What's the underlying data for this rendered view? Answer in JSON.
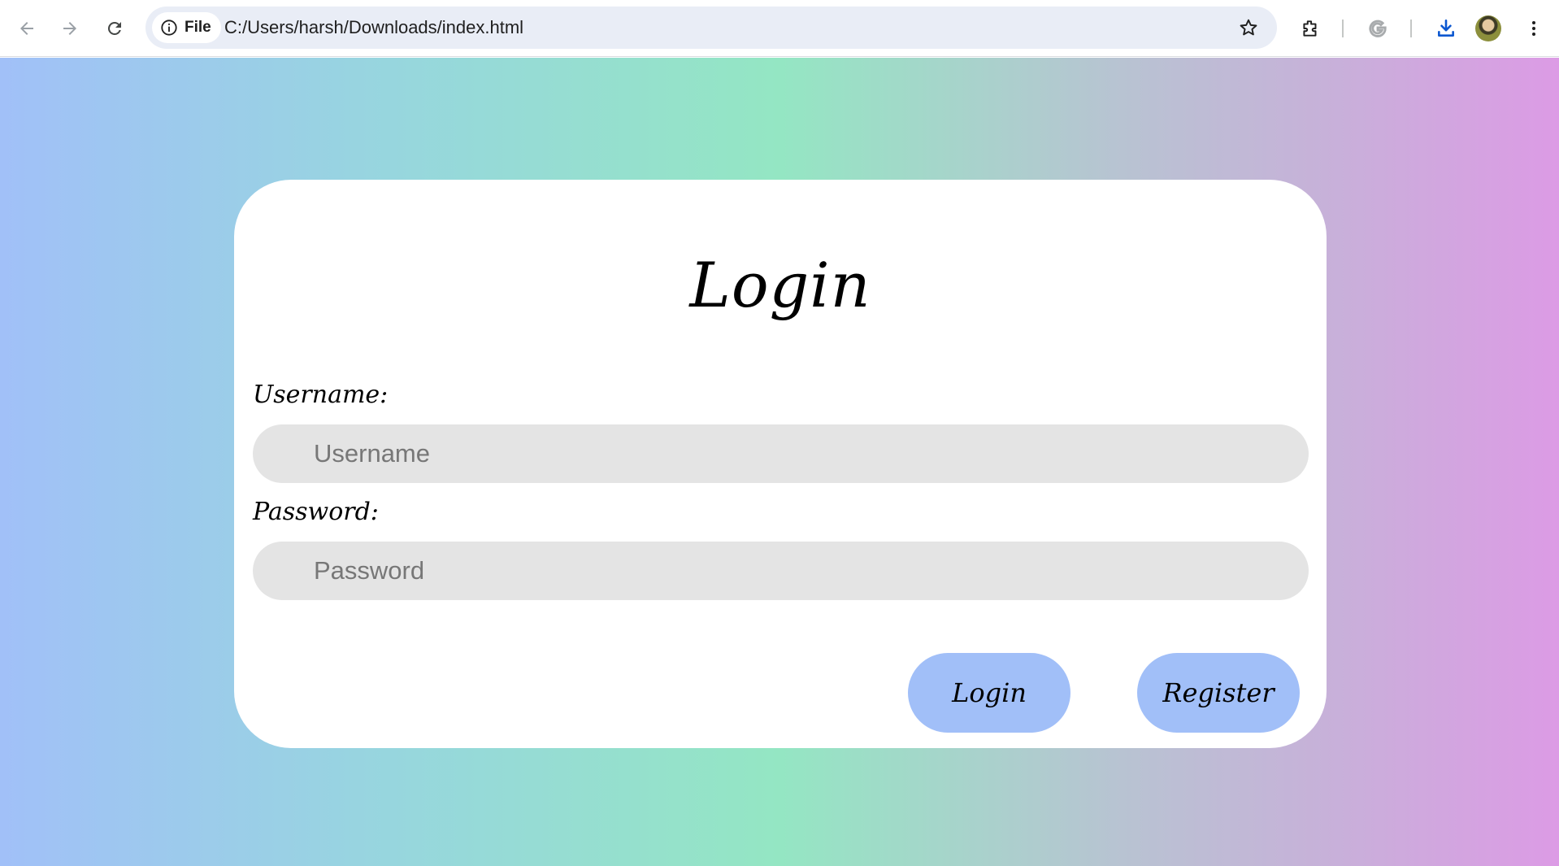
{
  "browser": {
    "site_info": "File",
    "url": "C:/Users/harsh/Downloads/index.html",
    "icons": [
      "back-arrow-icon",
      "forward-arrow-icon",
      "reload-icon",
      "info-icon",
      "star-icon",
      "extensions-icon",
      "google-g-icon",
      "download-icon",
      "avatar",
      "menu-kebab-icon"
    ]
  },
  "page": {
    "background_gradient": [
      "#a1c0f8",
      "#94e6c3",
      "#dc9be5"
    ]
  },
  "login_card": {
    "title": "Login",
    "username_label": "Username:",
    "username_placeholder": "Username",
    "username_value": "",
    "password_label": "Password:",
    "password_placeholder": "Password",
    "password_value": "",
    "login_button": "Login",
    "register_button": "Register",
    "button_color": "#a1bff8",
    "input_color": "#e4e4e4"
  }
}
